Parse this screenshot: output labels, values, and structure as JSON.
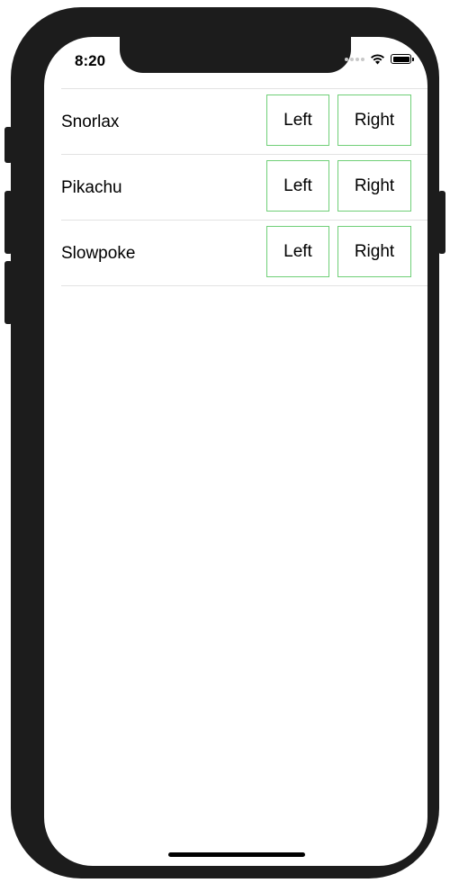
{
  "status_bar": {
    "time": "8:20"
  },
  "list": {
    "rows": [
      {
        "name": "Snorlax",
        "left_label": "Left",
        "right_label": "Right"
      },
      {
        "name": "Pikachu",
        "left_label": "Left",
        "right_label": "Right"
      },
      {
        "name": "Slowpoke",
        "left_label": "Left",
        "right_label": "Right"
      }
    ]
  },
  "colors": {
    "button_border": "#6fcf77",
    "device_frame": "#1c1c1c",
    "separator": "#e2e2e2"
  },
  "icons": {
    "signal": "cellular-signal-icon",
    "wifi": "wifi-icon",
    "battery": "battery-icon"
  }
}
